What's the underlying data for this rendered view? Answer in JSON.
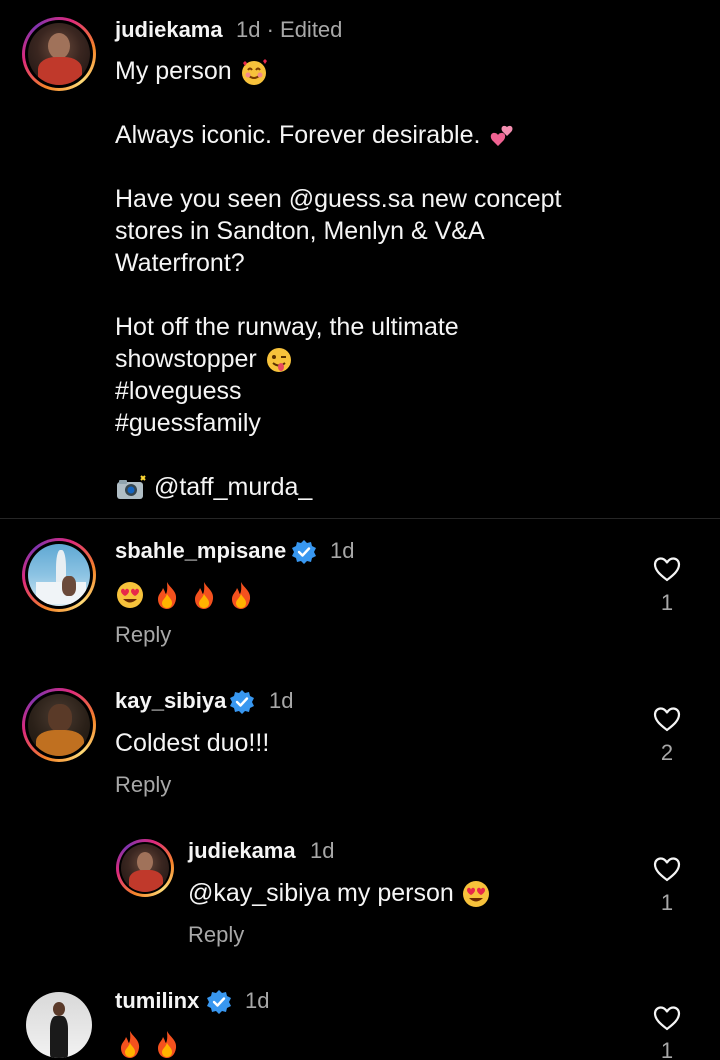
{
  "colors": {
    "background": "#000000",
    "text": "#f5f5f5",
    "muted": "#a8a8a8",
    "verified": "#3897f0",
    "divider": "#262626"
  },
  "caption": {
    "username": "judiekama",
    "meta": "1d · Edited",
    "line1": "My person",
    "line2": "Always iconic. Forever desirable.",
    "line3": "Have you seen @guess.sa new concept",
    "line4": "stores in Sandton, Menlyn & V&A",
    "line5": "Waterfront?",
    "line6": "Hot off the runway, the ultimate",
    "line7": "showstopper",
    "line8": "#loveguess",
    "line9": "#guessfamily",
    "line10": "@taff_murda_"
  },
  "comments": [
    {
      "username": "sbahle_mpisane",
      "time": "1d",
      "verified": true,
      "text_emojis": [
        "smiling-face-heart-eyes",
        "fire",
        "fire",
        "fire"
      ],
      "reply_label": "Reply",
      "likes": "1"
    },
    {
      "username": "kay_sibiya",
      "time": "1d",
      "verified": true,
      "text": "Coldest duo!!!",
      "reply_label": "Reply",
      "likes": "2"
    },
    {
      "username": "judiekama",
      "time": "1d",
      "verified": false,
      "text": "@kay_sibiya my person",
      "reply_label": "Reply",
      "likes": "1"
    },
    {
      "username": "tumilinx",
      "time": "1d",
      "verified": true,
      "text_emojis": [
        "fire",
        "fire"
      ],
      "likes": "1"
    }
  ]
}
